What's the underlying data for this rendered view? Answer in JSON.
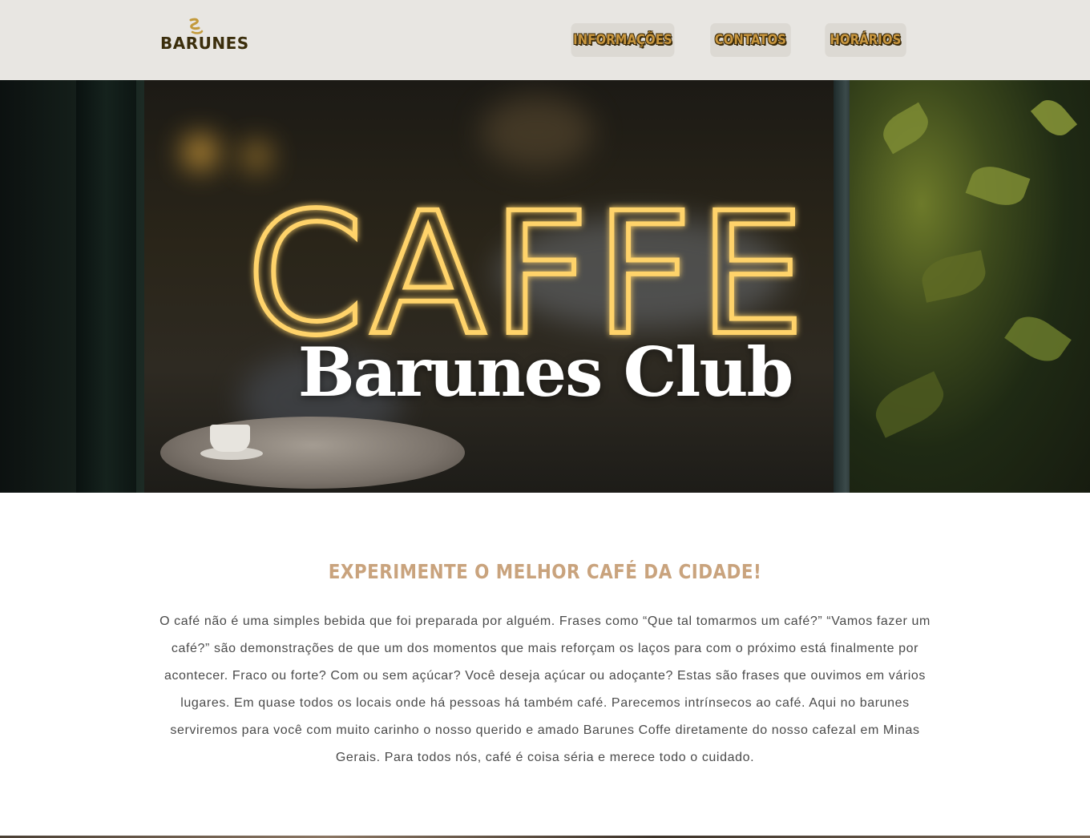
{
  "header": {
    "logo_text": "BARUNES",
    "nav": [
      {
        "label": "INFORMAÇÕES"
      },
      {
        "label": "CONTATOS"
      },
      {
        "label": "HORÁRIOS"
      }
    ]
  },
  "hero": {
    "neon_sign": "CAFFE",
    "title": "Barunes Club"
  },
  "intro": {
    "heading": "EXPERIMENTE O MELHOR CAFÉ DA CIDADE!",
    "body": "O café não é uma simples bebida que foi preparada por alguém. Frases como “Que tal tomarmos um café?” “Vamos fazer um café?” são demonstrações de que um dos momentos que mais reforçam os laços para com o próximo está finalmente por acontecer. Fraco ou forte? Com ou sem açúcar? Você deseja açúcar ou adoçante? Estas são frases que ouvimos em vários lugares. Em quase todos os locais onde há pessoas há também café. Parecemos intrínsecos ao café. Aqui no barunes serviremos para você com muito carinho o nosso querido e amado Barunes Coffe diretamente do nosso cafezal em Minas Gerais. Para todos nós, café é coisa séria e merece todo o cuidado."
  },
  "colors": {
    "header_bg": "#e8e6e2",
    "nav_text": "#c9973f",
    "heading_accent": "#c9a37d",
    "body_text": "#4a4a4a"
  }
}
